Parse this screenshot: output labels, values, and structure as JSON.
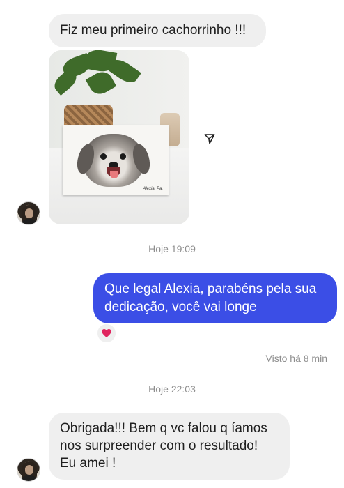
{
  "messages": {
    "first": "Fiz meu primeiro cachorrinho !!!",
    "photo_alt": "Desenho de cachorrinho",
    "photo_signature": "Alexia. Pa.",
    "timestamp_1": "Hoje 19:09",
    "outgoing": "Que legal Alexia, parabéns pela sua dedicação, você vai longe",
    "reaction_emoji": "❤️",
    "seen": "Visto há 8 min",
    "timestamp_2": "Hoje 22:03",
    "reply_lines": [
      "Obrigada!!! Bem q vc falou q íamos",
      "nos surpreender com o resultado!",
      "Eu amei !"
    ]
  },
  "colors": {
    "outgoing_bubble": "#3b4ee6",
    "incoming_bubble": "#efefef",
    "timestamp": "#8e8e8e",
    "reaction": "#e0245e"
  },
  "icons": {
    "share": "paper-plane-icon",
    "reaction": "heart-icon"
  }
}
